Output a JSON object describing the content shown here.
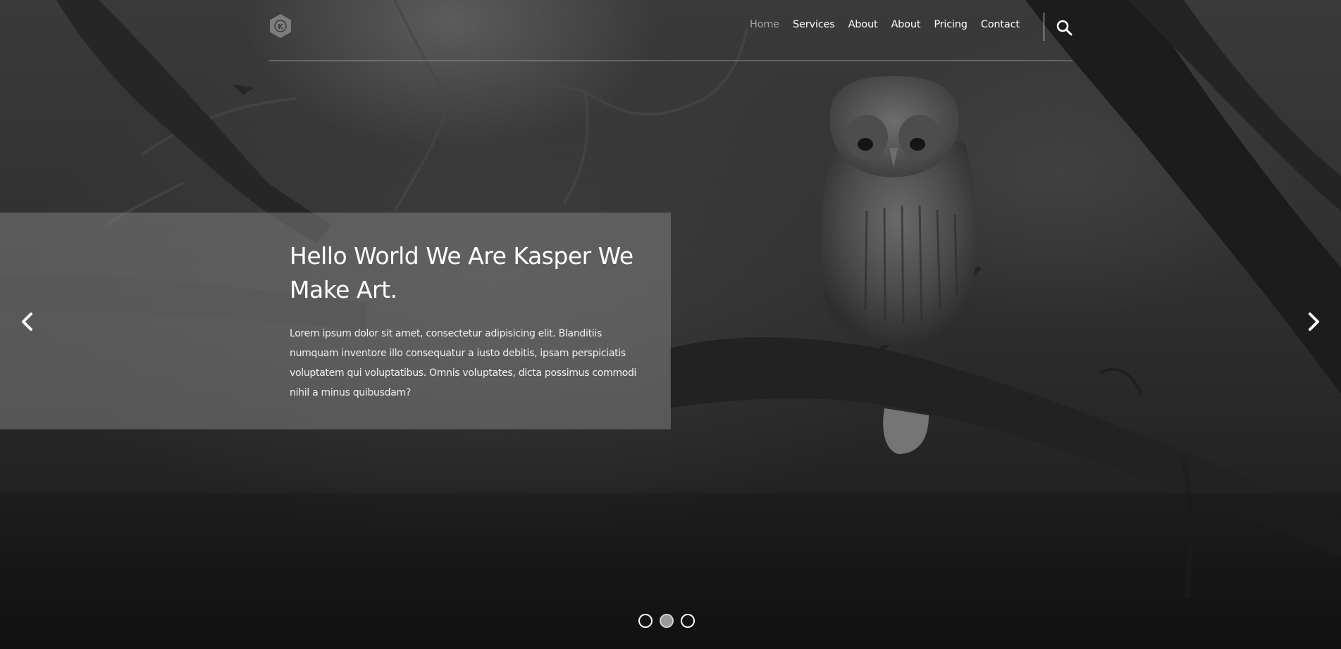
{
  "header": {
    "logo_letter": "K",
    "nav": [
      {
        "label": "Home",
        "active": true
      },
      {
        "label": "Services",
        "active": false
      },
      {
        "label": "About",
        "active": false
      },
      {
        "label": "About",
        "active": false
      },
      {
        "label": "Pricing",
        "active": false
      },
      {
        "label": "Contact",
        "active": false
      }
    ],
    "search_icon": "search-icon"
  },
  "slider": {
    "title": "Hello World We Are Kasper We Make Art.",
    "text": "Lorem ipsum dolor sit amet, consectetur adipisicing elit. Blanditiis numquam inventore illo consequatur a iusto debitis, ipsam perspiciatis voluptatem qui voluptatibus. Omnis voluptates, dicta possimus commodi nihil a minus quibusdam?",
    "prev_icon": "chevron-left-icon",
    "next_icon": "chevron-right-icon",
    "dots_total": 3,
    "active_dot": 2
  },
  "colors": {
    "nav_active": "#a3a3a3",
    "text": "#ffffff",
    "panel": "rgba(125,125,125,0.55)"
  }
}
